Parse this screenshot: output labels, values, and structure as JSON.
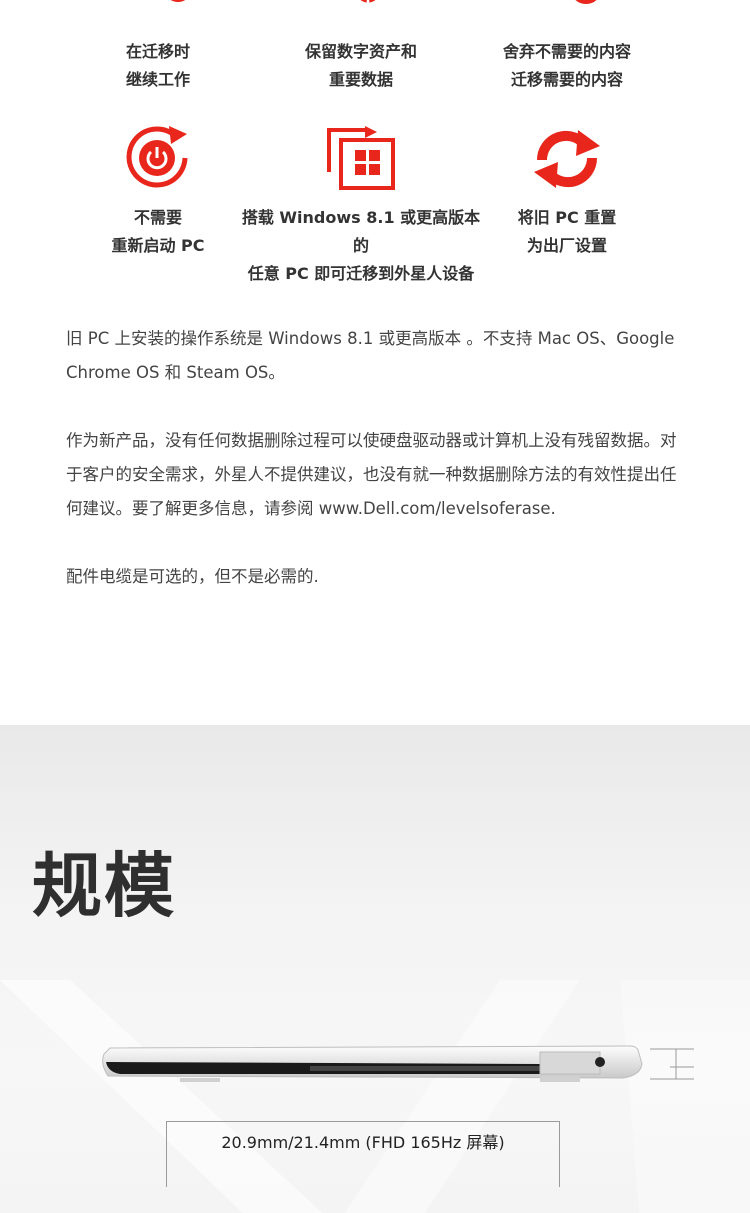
{
  "features": [
    {
      "lines": [
        "在迁移时",
        "继续工作"
      ],
      "icon": "monitor-check-icon"
    },
    {
      "lines": [
        "保留数字资产和",
        "重要数据"
      ],
      "icon": "money-card-icon"
    },
    {
      "lines": [
        "舍弃不需要的内容",
        "迁移需要的内容"
      ],
      "icon": "edit-check-icon"
    },
    {
      "lines": [
        "不需要",
        "重新启动 PC"
      ],
      "icon": "power-restart-icon"
    },
    {
      "lines": [
        "搭载 Windows 8.1 或更高版本的",
        "任意 PC 即可迁移到外星人设备"
      ],
      "icon": "windows-transfer-icon"
    },
    {
      "lines": [
        "将旧 PC 重置",
        "为出厂设置"
      ],
      "icon": "reset-arrows-icon"
    }
  ],
  "notes": [
    "旧 PC 上安装的操作系统是 Windows 8.1 或更高版本 。不支持 Mac OS、Google Chrome OS 和 Steam OS。",
    "作为新产品，没有任何数据删除过程可以使硬盘驱动器或计算机上没有残留数据。对于客户的安全需求，外星人不提供建议，也没有就一种数据删除方法的有效性提出任何建议。要了解更多信息，请参阅 www.Dell.com/levelsoferase.",
    "配件电缆是可选的，但不是必需的."
  ],
  "specs": {
    "title": "规模",
    "thickness": "20.9mm/21.4mm (FHD 165Hz 屏幕)"
  },
  "colors": {
    "accent": "#e8261b",
    "text": "#333333",
    "background_gray": "#efefef"
  }
}
